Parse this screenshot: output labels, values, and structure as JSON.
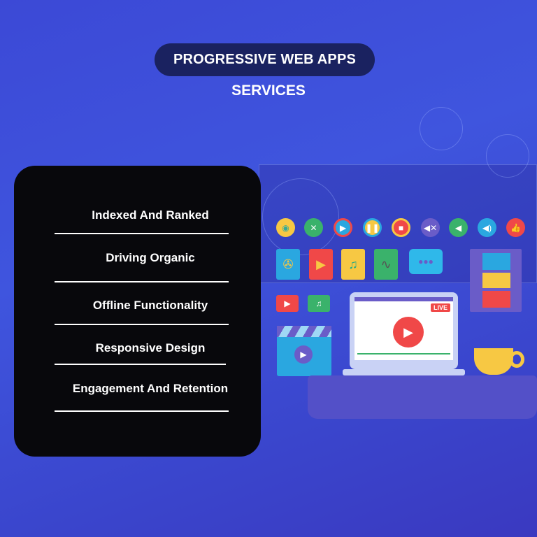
{
  "header": {
    "title": "PROGRESSIVE WEB APPS",
    "subtitle": "SERVICES"
  },
  "services": {
    "items": [
      {
        "label": "Indexed And Ranked"
      },
      {
        "label": "Driving Organic"
      },
      {
        "label": "Offline Functionality"
      },
      {
        "label": "Responsive Design"
      },
      {
        "label": "Engagement And Retention"
      }
    ]
  },
  "illustration": {
    "live_badge": "LIVE",
    "icons": [
      "eye-icon",
      "expand-icon",
      "play-icon",
      "pause-icon",
      "stop-icon",
      "mute-icon",
      "volume-low-icon",
      "volume-high-icon",
      "thumbs-up-icon"
    ],
    "colors": {
      "background": "#3f55de",
      "panel": "#08080c",
      "pill": "#1a2260",
      "red": "#f04848",
      "yellow": "#f7c843",
      "green": "#3ab26b",
      "cyan": "#2aa7e0"
    }
  }
}
